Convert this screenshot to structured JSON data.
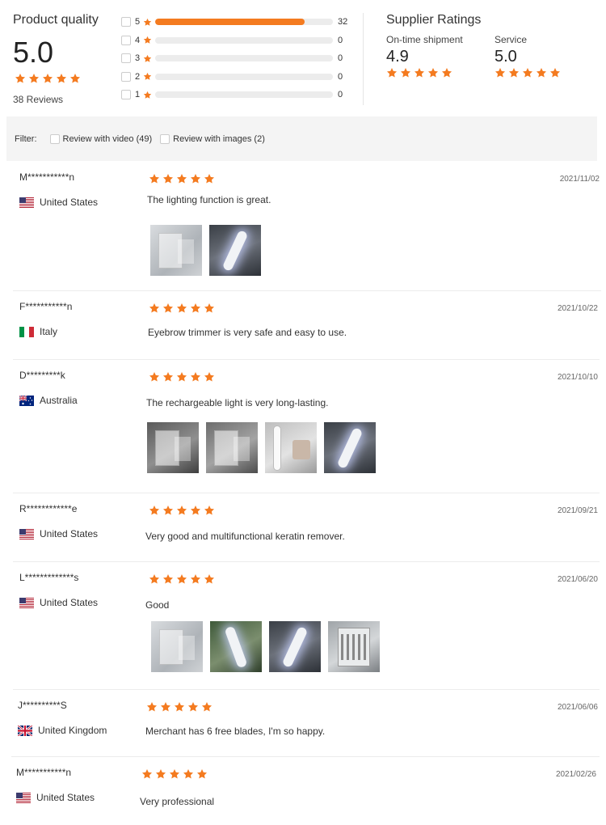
{
  "product_quality": {
    "title": "Product quality",
    "score": "5.0",
    "stars": 5,
    "reviews_count_text": "38 Reviews"
  },
  "distribution": [
    {
      "stars": "5",
      "count": "32",
      "fraction": 0.842
    },
    {
      "stars": "4",
      "count": "0",
      "fraction": 0
    },
    {
      "stars": "3",
      "count": "0",
      "fraction": 0
    },
    {
      "stars": "2",
      "count": "0",
      "fraction": 0
    },
    {
      "stars": "1",
      "count": "0",
      "fraction": 0
    }
  ],
  "supplier_ratings": {
    "title": "Supplier Ratings",
    "ontime": {
      "label": "On-time shipment",
      "value": "4.9",
      "stars": 5
    },
    "service": {
      "label": "Service",
      "value": "5.0",
      "stars": 5
    }
  },
  "filter": {
    "label": "Filter:",
    "options": [
      {
        "label": "Review with video (49)"
      },
      {
        "label": "Review with images (2)"
      }
    ]
  },
  "reviews": [
    {
      "name": "M***********n",
      "country": "United States",
      "flag": "us",
      "date": "2021/11/02",
      "text": "The lighting function is great.",
      "stars": 5,
      "images": [
        "thumb-packaging-open",
        "thumb-lit-device"
      ]
    },
    {
      "name": "F***********n",
      "country": "Italy",
      "flag": "it",
      "date": "2021/10/22",
      "text": "Eyebrow trimmer is very safe and easy to use.",
      "stars": 5,
      "images": []
    },
    {
      "name": "D*********k",
      "country": "Australia",
      "flag": "au",
      "date": "2021/10/10",
      "text": "The rechargeable light is very long-lasting.",
      "stars": 5,
      "images": [
        "thumb-box-front",
        "thumb-device-box",
        "thumb-device-cap",
        "thumb-lit-device"
      ]
    },
    {
      "name": "R************e",
      "country": "United States",
      "flag": "us",
      "date": "2021/09/21",
      "text": "Very good and multifunctional keratin remover.",
      "stars": 5,
      "images": []
    },
    {
      "name": "L*************s",
      "country": "United States",
      "flag": "us",
      "date": "2021/06/20",
      "text": "Good",
      "stars": 5,
      "images": [
        "thumb-packaging-open",
        "thumb-device-plant",
        "thumb-lit-device",
        "thumb-blades"
      ]
    },
    {
      "name": "J**********S",
      "country": "United Kingdom",
      "flag": "uk",
      "date": "2021/06/06",
      "text": "Merchant has 6 free blades, I'm so happy.",
      "stars": 5,
      "images": []
    },
    {
      "name": "M***********n",
      "country": "United States",
      "flag": "us",
      "date": "2021/02/26",
      "text": "Very professional",
      "stars": 5,
      "images": []
    }
  ],
  "colors": {
    "accent": "#f47b20",
    "track": "#ececec",
    "filter_bg": "#f4f4f4"
  }
}
